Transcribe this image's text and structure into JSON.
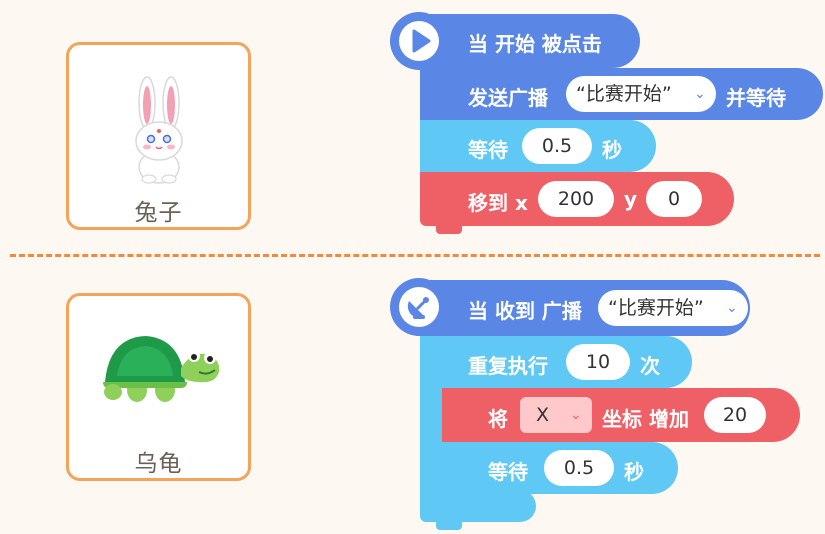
{
  "sprites": {
    "rabbit": {
      "name": "兔子"
    },
    "turtle": {
      "name": "乌龟"
    }
  },
  "script1": {
    "hat": {
      "label": "当 开始 被点击",
      "icon": "play-icon"
    },
    "broadcast_wait": {
      "prefix": "发送广播",
      "message": "“比赛开始”",
      "suffix": "并等待"
    },
    "wait": {
      "prefix": "等待",
      "value": "0.5",
      "unit": "秒"
    },
    "goto": {
      "prefix": "移到 x",
      "x": "200",
      "ylabel": "y",
      "y": "0"
    }
  },
  "script2": {
    "hat": {
      "label": "当 收到 广播",
      "message": "“比赛开始”",
      "icon": "satellite-dish-icon"
    },
    "repeat": {
      "prefix": "重复执行",
      "count": "10",
      "unit": "次"
    },
    "change_x": {
      "prefix": "将",
      "axis": "X",
      "middle": "坐标 增加",
      "amount": "20"
    },
    "wait": {
      "prefix": "等待",
      "value": "0.5",
      "unit": "秒"
    }
  },
  "colors": {
    "event_blue": "#5a87e6",
    "control_lightblue": "#5fc8f4",
    "motion_red": "#ef6066",
    "card_border": "#f4a35a",
    "divider": "#f08a3c"
  }
}
